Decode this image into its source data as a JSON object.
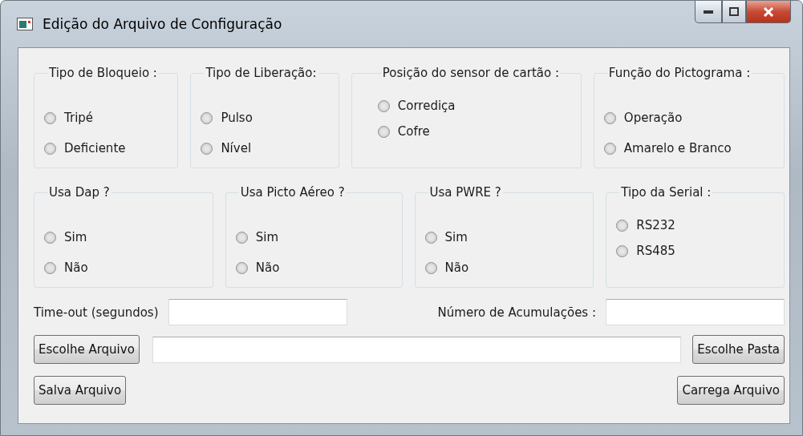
{
  "window": {
    "title": "Edição do Arquivo de Configuração"
  },
  "group_rows": [
    [
      {
        "title": "Tipo de Bloqueio :",
        "options": [
          {
            "label": "Tripé",
            "selected": false
          },
          {
            "label": "Deficiente",
            "selected": false
          }
        ]
      },
      {
        "title": "Tipo de Liberação:",
        "options": [
          {
            "label": "Pulso",
            "selected": false
          },
          {
            "label": "Nível",
            "selected": false
          }
        ]
      },
      {
        "title": "Posição do sensor de cartão :",
        "options": [
          {
            "label": "Corrediça",
            "selected": false
          },
          {
            "label": "Cofre",
            "selected": false
          }
        ]
      },
      {
        "title": "Função do Pictograma :",
        "options": [
          {
            "label": "Operação",
            "selected": false
          },
          {
            "label": "Amarelo e Branco",
            "selected": false
          }
        ]
      }
    ],
    [
      {
        "title": "Usa Dap ?",
        "options": [
          {
            "label": "Sim",
            "selected": false
          },
          {
            "label": "Não",
            "selected": false
          }
        ]
      },
      {
        "title": "Usa Picto Aéreo ?",
        "options": [
          {
            "label": "Sim",
            "selected": false
          },
          {
            "label": "Não",
            "selected": false
          }
        ]
      },
      {
        "title": "Usa PWRE ?",
        "options": [
          {
            "label": "Sim",
            "selected": false
          },
          {
            "label": "Não",
            "selected": false
          }
        ]
      },
      {
        "title": "Tipo da Serial :",
        "options": [
          {
            "label": "RS232",
            "selected": false
          },
          {
            "label": "RS485",
            "selected": false
          }
        ]
      }
    ]
  ],
  "timeout": {
    "label": "Time-out (segundos)"
  },
  "accumulations": {
    "label": "Número de Acumulações :"
  },
  "buttons": {
    "choose_file": "Escolhe Arquivo",
    "choose_folder": "Escolhe Pasta",
    "save_file": "Salva Arquivo",
    "load_file": "Carrega Arquivo"
  }
}
